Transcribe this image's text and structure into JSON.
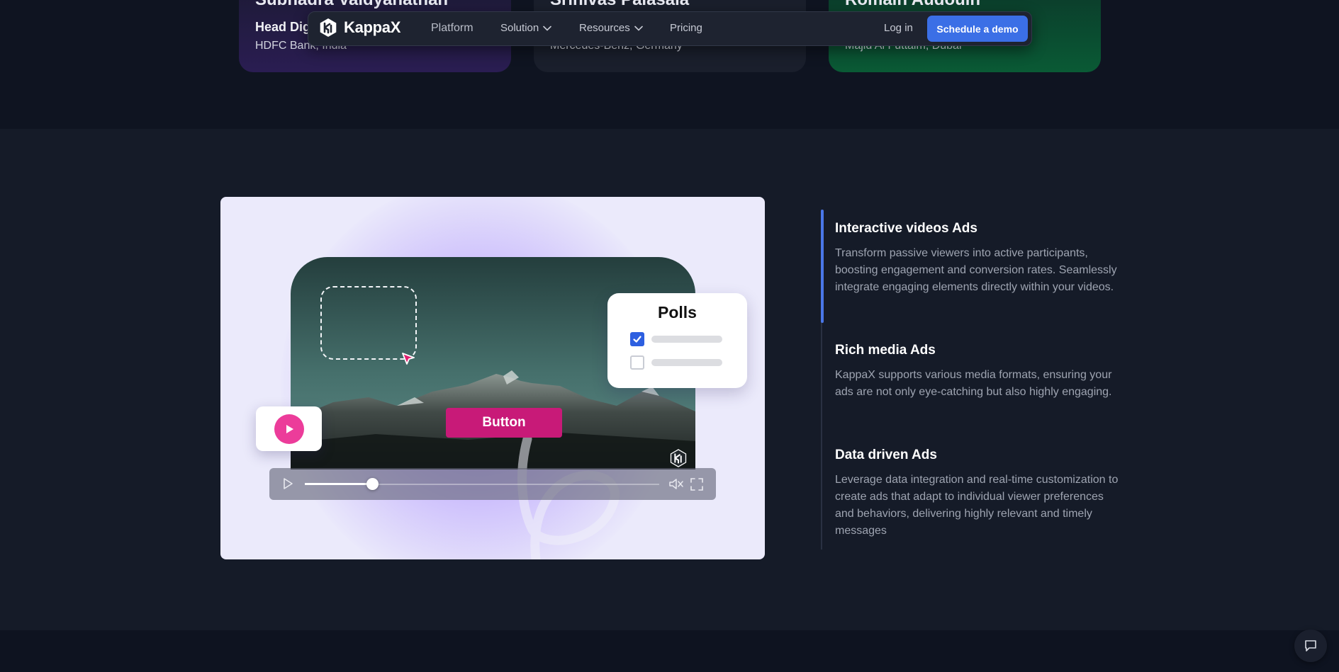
{
  "testimonials": [
    {
      "name": "Subhadra Vaidyanathan",
      "role": "Head Dig",
      "company": "HDFC Bank, India"
    },
    {
      "name": "Srinivas Palasala",
      "role": "",
      "company": "Mercedes-Benz, Germany"
    },
    {
      "name": "Romain Audouin",
      "role": "",
      "company": "Majid Al Futtaim, Dubai"
    }
  ],
  "nav": {
    "brand": "KappaX",
    "links": {
      "platform": "Platform",
      "solution": "Solution",
      "resources": "Resources",
      "pricing": "Pricing"
    },
    "login": "Log in",
    "cta": "Schedule a demo"
  },
  "showcase": {
    "polls_title": "Polls",
    "button_label": "Button",
    "poll_options": [
      {
        "checked": true
      },
      {
        "checked": false
      }
    ],
    "playback_progress": 0.19
  },
  "features": [
    {
      "title": "Interactive videos Ads",
      "description": "Transform passive viewers into active participants, boosting engagement and conversion rates. Seamlessly integrate engaging elements directly within your videos.",
      "active": true
    },
    {
      "title": "Rich media Ads",
      "description": "KappaX supports various media formats, ensuring your ads are not only eye-catching but also highly engaging.",
      "active": false
    },
    {
      "title": "Data driven Ads",
      "description": "Leverage data integration and real-time customization to create ads that adapt to individual viewer preferences and behaviors, delivering highly relevant and timely messages",
      "active": false
    }
  ],
  "colors": {
    "accent": "#3b6fe6",
    "pink_button": "#c81a78",
    "play_pink": "#ec3c9a",
    "background": "#151b28"
  },
  "icons": {
    "chat": "chat-bubble-icon",
    "logo": "kappax-logo-icon"
  }
}
